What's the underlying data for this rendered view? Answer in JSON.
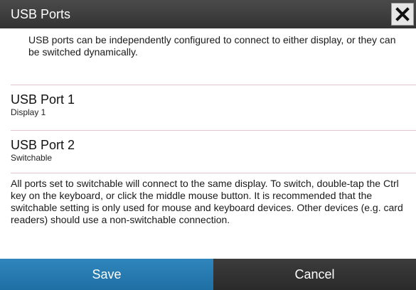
{
  "dialog": {
    "title": "USB Ports",
    "close_icon": "close-icon"
  },
  "intro": "USB ports can be independently configured to connect to either display, or they can be switched dynamically.",
  "ports": [
    {
      "name": "USB Port 1",
      "setting": "Display 1"
    },
    {
      "name": "USB Port 2",
      "setting": "Switchable"
    }
  ],
  "note": "All ports set to switchable will connect to the same display. To switch, double-tap the Ctrl key on the keyboard, or click the middle mouse button. It is recommended that the switchable setting is only used for mouse and keyboard devices. Other devices (e.g. card readers) should use a non-switchable connection.",
  "buttons": {
    "save": "Save",
    "cancel": "Cancel"
  },
  "colors": {
    "titlebar": "#3a3a3a",
    "save": "#2579b0",
    "cancel": "#333333",
    "separator": "#e3c6cc"
  }
}
